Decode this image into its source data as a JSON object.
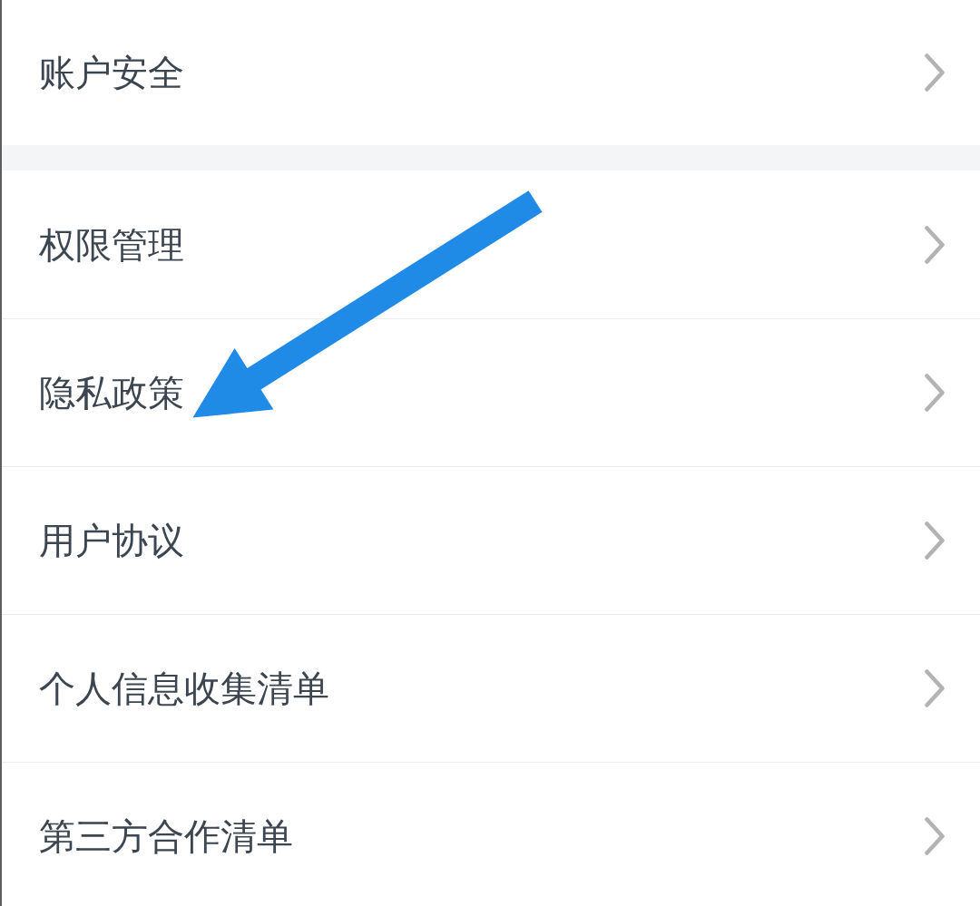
{
  "sections": [
    {
      "items": [
        {
          "label": "账户安全",
          "annotated": false
        }
      ]
    },
    {
      "items": [
        {
          "label": "权限管理",
          "annotated": false
        },
        {
          "label": "隐私政策",
          "annotated": true
        },
        {
          "label": "用户协议",
          "annotated": false
        },
        {
          "label": "个人信息收集清单",
          "annotated": false
        },
        {
          "label": "第三方合作清单",
          "annotated": false
        }
      ]
    }
  ]
}
